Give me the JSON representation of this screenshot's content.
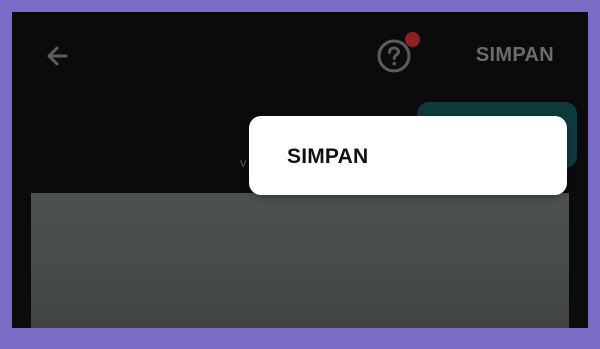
{
  "appbar": {
    "back_icon": "arrow-left-icon",
    "help_icon": "question-circle-icon",
    "save_label": "SIMPAN"
  },
  "background_text": "v",
  "popup": {
    "item_label": "SIMPAN"
  },
  "colors": {
    "outer_border": "#7b6cc8",
    "screen_background": "#0b0b0b",
    "notification_dot": "#8e1f25",
    "teal_button": "#0f3a3d",
    "card_gray": "#4a4f4d",
    "popup_background": "#ffffff"
  }
}
